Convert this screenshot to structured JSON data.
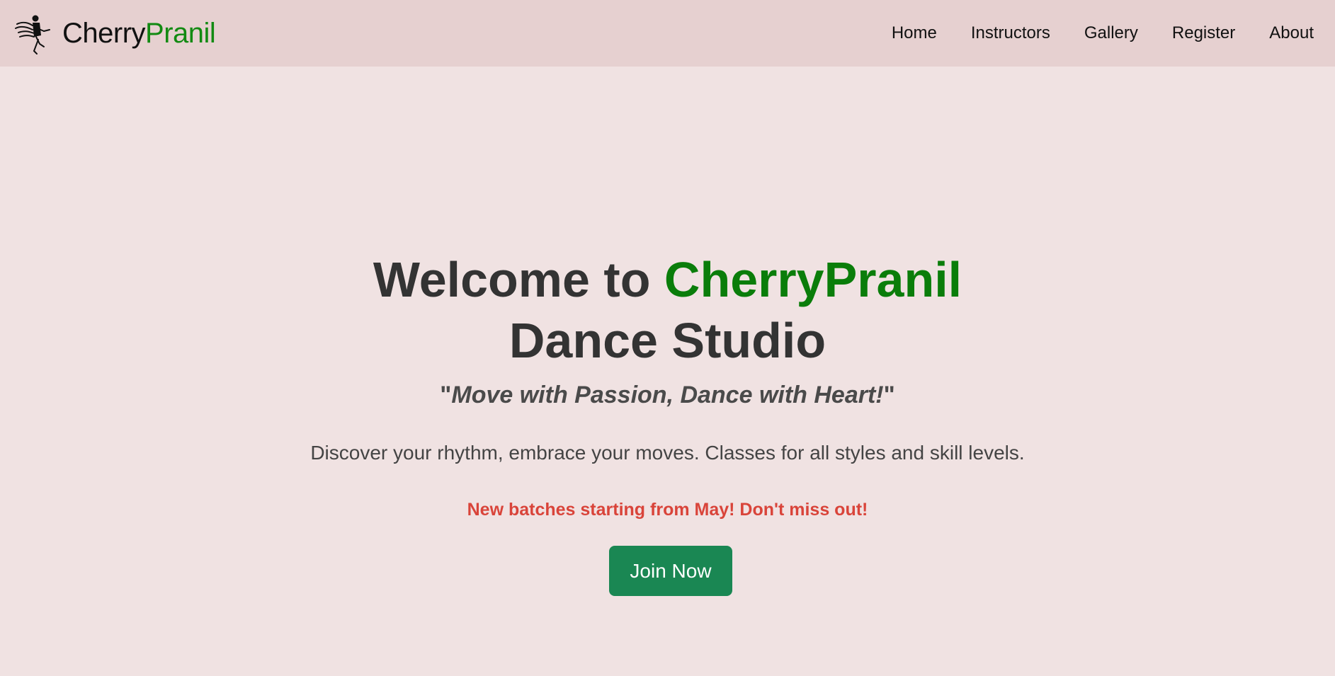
{
  "brand": {
    "name_part1": "Cherry",
    "name_part2": "Pranil",
    "logo_icon": "dancer-logo-icon"
  },
  "nav": {
    "items": [
      {
        "label": "Home"
      },
      {
        "label": "Instructors"
      },
      {
        "label": "Gallery"
      },
      {
        "label": "Register"
      },
      {
        "label": "About"
      }
    ]
  },
  "hero": {
    "title_prefix": "Welcome to ",
    "title_accent": "CherryPranil",
    "title_line2": "Dance Studio",
    "tagline_open_quote": "\"",
    "tagline_text": "Move with Passion, Dance with Heart!",
    "tagline_close_quote": "\"",
    "description": "Discover your rhythm, embrace your moves. Classes for all styles and skill levels.",
    "announcement": "New batches starting from May! Don't miss out!",
    "cta_label": "Join Now"
  },
  "colors": {
    "navbar_bg": "#e6d0d0",
    "page_bg": "#f0e2e2",
    "brand_accent": "#128a12",
    "title_accent": "#0a7d0a",
    "announcement": "#d9443a",
    "cta_bg": "#1a8753"
  }
}
